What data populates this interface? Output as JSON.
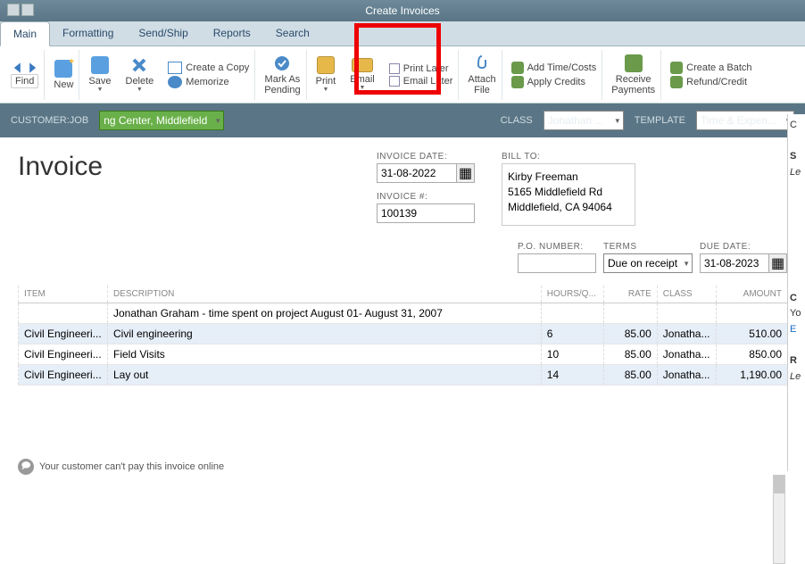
{
  "window": {
    "title": "Create Invoices"
  },
  "tabs": [
    "Main",
    "Formatting",
    "Send/Ship",
    "Reports",
    "Search"
  ],
  "ribbon": {
    "find": "Find",
    "new": "New",
    "save": "Save",
    "delete": "Delete",
    "create_copy": "Create a Copy",
    "memorize": "Memorize",
    "mark_pending_l1": "Mark As",
    "mark_pending_l2": "Pending",
    "print": "Print",
    "email": "Email",
    "print_later": "Print Later",
    "email_later": "Email Later",
    "attach_l1": "Attach",
    "attach_l2": "File",
    "add_time": "Add Time/Costs",
    "apply_credits": "Apply Credits",
    "receive_l1": "Receive",
    "receive_l2": "Payments",
    "create_batch": "Create a Batch",
    "refund": "Refund/Credit"
  },
  "subheader": {
    "customer_lbl": "CUSTOMER:JOB",
    "customer_val": "ng Center, Middlefield",
    "class_lbl": "CLASS",
    "class_val": "Jonathan ...",
    "template_lbl": "TEMPLATE",
    "template_val": "Time & Expen..."
  },
  "invoice": {
    "heading": "Invoice",
    "date_lbl": "INVOICE DATE:",
    "date_val": "31-08-2022",
    "num_lbl": "INVOICE #:",
    "num_val": "100139",
    "bill_lbl": "BILL TO:",
    "bill_name": "Kirby Freeman",
    "bill_addr1": "5165 Middlefield Rd",
    "bill_addr2": "Middlefield, CA 94064",
    "po_lbl": "P.O. NUMBER:",
    "po_val": "",
    "terms_lbl": "TERMS",
    "terms_val": "Due on receipt",
    "due_lbl": "DUE DATE:",
    "due_val": "31-08-2023"
  },
  "table": {
    "headers": [
      "ITEM",
      "DESCRIPTION",
      "HOURS/Q...",
      "RATE",
      "CLASS",
      "AMOUNT"
    ],
    "rows": [
      {
        "item": "",
        "desc": "Jonathan Graham - time spent on project August 01- August 31, 2007",
        "hours": "",
        "rate": "",
        "class": "",
        "amount": ""
      },
      {
        "item": "Civil Engineeri...",
        "desc": "Civil engineering",
        "hours": "6",
        "rate": "85.00",
        "class": "Jonatha...",
        "amount": "510.00"
      },
      {
        "item": "Civil Engineeri...",
        "desc": "Field Visits",
        "hours": "10",
        "rate": "85.00",
        "class": "Jonatha...",
        "amount": "850.00"
      },
      {
        "item": "Civil Engineeri...",
        "desc": "Lay out",
        "hours": "14",
        "rate": "85.00",
        "class": "Jonatha...",
        "amount": "1,190.00"
      }
    ]
  },
  "footer": {
    "msg": "Your customer can't pay this invoice online"
  },
  "side": {
    "c1": "C",
    "s": "S",
    "l1": "Le",
    "c2": "C",
    "y": "Yo",
    "e": "E",
    "r": "R",
    "l2": "Le"
  }
}
